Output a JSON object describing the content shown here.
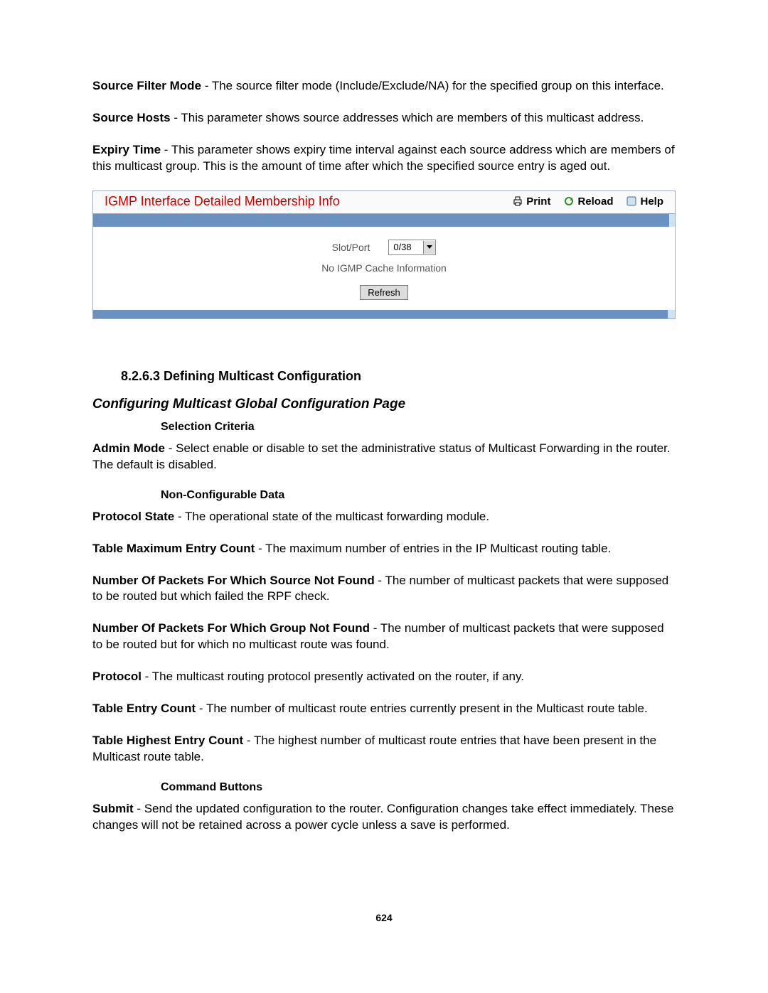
{
  "definitions_top": [
    {
      "label": "Source Filter Mode",
      "text": " - The source filter mode (Include/Exclude/NA) for the specified group on this interface."
    },
    {
      "label": "Source Hosts",
      "text": " - This parameter shows source addresses which are members of this multicast address."
    },
    {
      "label": "Expiry Time",
      "text": " - This parameter shows expiry time interval against each source address which are members of this multicast group. This is the amount of time after which the specified source entry is aged out."
    }
  ],
  "panel": {
    "title": "IGMP Interface Detailed Membership Info",
    "actions": {
      "print": "Print",
      "reload": "Reload",
      "help": "Help"
    },
    "slot_port_label": "Slot/Port",
    "slot_port_value": "0/38",
    "cache_msg": "No IGMP Cache Information",
    "refresh_label": "Refresh"
  },
  "section": {
    "number_title": "8.2.6.3 Defining Multicast Configuration",
    "subtitle": "Configuring Multicast Global Configuration Page",
    "selection_criteria": "Selection Criteria",
    "non_configurable": "Non-Configurable Data",
    "command_buttons": "Command Buttons"
  },
  "definitions_selection": [
    {
      "label": "Admin Mode",
      "text": " - Select enable or disable to set the administrative status of Multicast Forwarding in the router. The default is disabled."
    }
  ],
  "definitions_noncfg": [
    {
      "label": "Protocol State",
      "text": " - The operational state of the multicast forwarding module."
    },
    {
      "label": "Table Maximum Entry Count",
      "text": " - The maximum number of entries in the IP Multicast routing table."
    },
    {
      "label": "Number Of Packets For Which Source Not Found",
      "text": " - The number of multicast packets that were supposed to be routed but which failed the RPF check."
    },
    {
      "label": "Number Of Packets For Which Group Not Found",
      "text": " - The number of multicast packets that were supposed to be routed but for which no multicast route was found."
    },
    {
      "label": "Protocol",
      "text": " - The multicast routing protocol presently activated on the router, if any."
    },
    {
      "label": "Table Entry Count",
      "text": " - The number of multicast route entries currently present in the Multicast route table."
    },
    {
      "label": "Table Highest Entry Count",
      "text": " - The highest number of multicast route entries that have been present in the Multicast route table."
    }
  ],
  "definitions_cmd": [
    {
      "label": "Submit",
      "text": " - Send the updated configuration to the router. Configuration changes take effect immediately. These changes will not be retained across a power cycle unless a save is performed."
    }
  ],
  "page_number": "624"
}
